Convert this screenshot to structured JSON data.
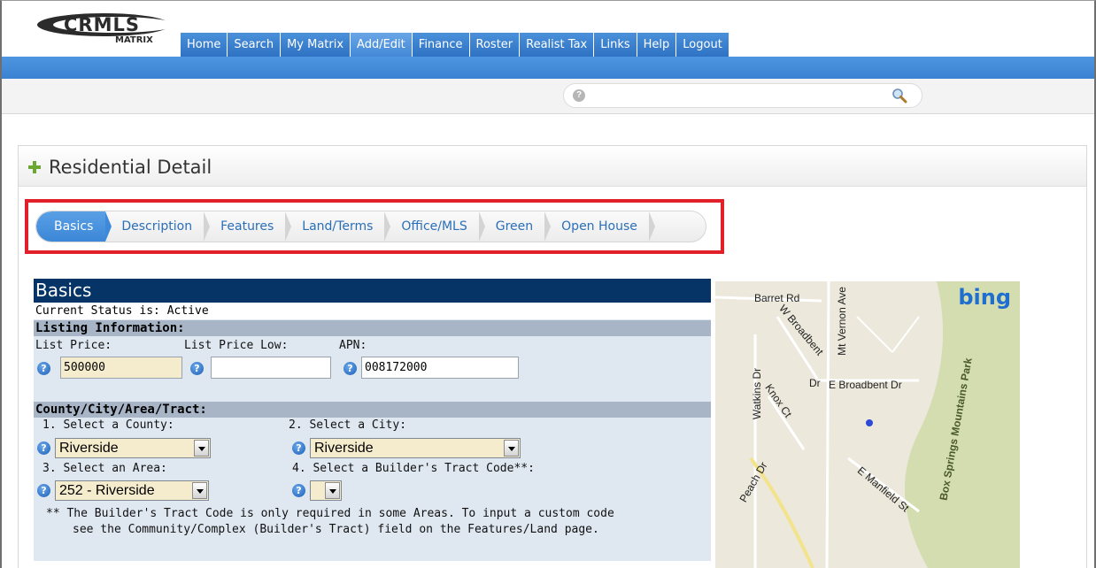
{
  "header": {
    "logo_brand": "CRMLS",
    "logo_sub": "MATRIX",
    "nav": [
      "Home",
      "Search",
      "My Matrix",
      "Add/Edit",
      "Finance",
      "Roster",
      "Realist Tax",
      "Links",
      "Help",
      "Logout"
    ],
    "active_nav": "Add/Edit"
  },
  "search": {
    "placeholder": ""
  },
  "panel": {
    "title": "Residential Detail",
    "tabs": [
      "Basics",
      "Description",
      "Features",
      "Land/Terms",
      "Office/MLS",
      "Green",
      "Open House"
    ],
    "active_tab": "Basics"
  },
  "form": {
    "title": "Basics",
    "status": "Current Status is: Active",
    "listing_section": "Listing Information:",
    "list_price_label": "List Price:",
    "list_price_value": "500000",
    "list_price_low_label": "List Price Low:",
    "list_price_low_value": "",
    "apn_label": "APN:",
    "apn_value": "008172000",
    "county_section": "County/City/Area/Tract:",
    "county_label": "1. Select a County:",
    "county_value": "Riverside",
    "city_label": "2. Select a City:",
    "city_value": "Riverside",
    "area_label": "3. Select an Area:",
    "area_value": "252 - Riverside",
    "tract_label": "4. Select a Builder's Tract Code**:",
    "tract_value": "",
    "note_line1": "** The Builder's Tract Code is only required in some Areas. To input a custom code",
    "note_line2": "see the Community/Complex (Builder's Tract) field on the Features/Land page."
  },
  "map": {
    "brand": "bing",
    "labels": [
      "Barret Rd",
      "W Broadbent",
      "Mt Vernon Ave",
      "Watkins Dr",
      "Knox Ct",
      "Dr",
      "E Broadbent Dr",
      "Peach Dr",
      "E Manfield St",
      "Box Springs Mountains Park"
    ]
  },
  "colors": {
    "nav_blue": "#3a82d2",
    "form_header": "#063466",
    "highlight_red": "#e2202a",
    "required_fill": "#f4eccc"
  }
}
